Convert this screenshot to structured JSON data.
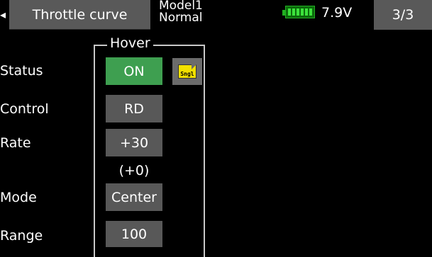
{
  "header": {
    "title": "Throttle curve",
    "model_name": "Model1",
    "condition": "Normal",
    "voltage": "7.9V",
    "battery_level": 1.0,
    "page": "3/3"
  },
  "group": {
    "title": "Hover"
  },
  "rows": {
    "status": {
      "label": "Status",
      "value": "ON"
    },
    "control": {
      "label": "Control",
      "value": "RD"
    },
    "rate": {
      "label": "Rate",
      "value": "+30",
      "offset": "(+0)"
    },
    "mode": {
      "label": "Mode",
      "value": "Center"
    },
    "range": {
      "label": "Range",
      "value": "100"
    }
  },
  "sngl_button": {
    "label": "Sngl",
    "icon": "document-icon"
  },
  "colors": {
    "header_bg": "#595959",
    "button_bg": "#585858",
    "on_green": "#3e9f50",
    "battery_green": "#3ce23c",
    "sngl_yellow": "#f2e000"
  }
}
